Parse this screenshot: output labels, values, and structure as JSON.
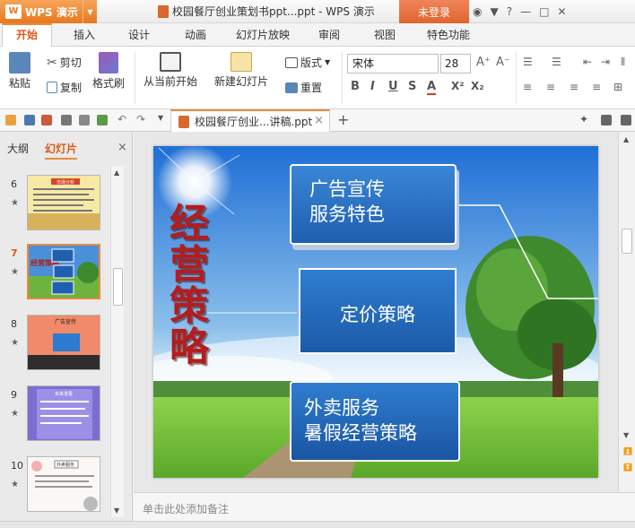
{
  "app": {
    "menu_label": "WPS 演示",
    "logo_text": "W",
    "window_title": "校园餐厅创业策划书ppt...ppt - WPS 演示",
    "login_label": "未登录"
  },
  "menu_tabs": [
    "开始",
    "插入",
    "设计",
    "动画",
    "幻灯片放映",
    "审阅",
    "视图",
    "特色功能"
  ],
  "ribbon": {
    "paste": "粘贴",
    "cut": "剪切",
    "copy": "复制",
    "format_painter": "格式刷",
    "from_current": "从当前开始",
    "new_slide": "新建幻灯片",
    "layout": "版式",
    "reset": "重置",
    "font_name": "宋体",
    "font_size": "28",
    "format_buttons": [
      "B",
      "I",
      "U",
      "S",
      "A",
      "X²",
      "X₂"
    ]
  },
  "document_tab": {
    "label": "校园餐厅创业...讲稿.ppt",
    "close": "×",
    "new_tab": "+"
  },
  "left_panel": {
    "tabs": [
      "大纲",
      "幻灯片"
    ],
    "close": "×",
    "slides": [
      {
        "number": "6",
        "title": "市场分析"
      },
      {
        "number": "7",
        "title": "经营策略"
      },
      {
        "number": "8",
        "title": "广告宣传"
      },
      {
        "number": "9",
        "title": "未来发展"
      },
      {
        "number": "10",
        "title": "外卖服务"
      }
    ]
  },
  "slide": {
    "title": "经营策略",
    "box1": [
      "广告宣传",
      "服务特色"
    ],
    "box2": "定价策略",
    "box3": [
      "外卖服务",
      "暑假经营策略"
    ]
  },
  "notes_placeholder": "单击此处添加备注",
  "colors": {
    "accent": "#e98a3d",
    "title_red": "#b21d1d",
    "box_blue": "#1f5fb0"
  }
}
